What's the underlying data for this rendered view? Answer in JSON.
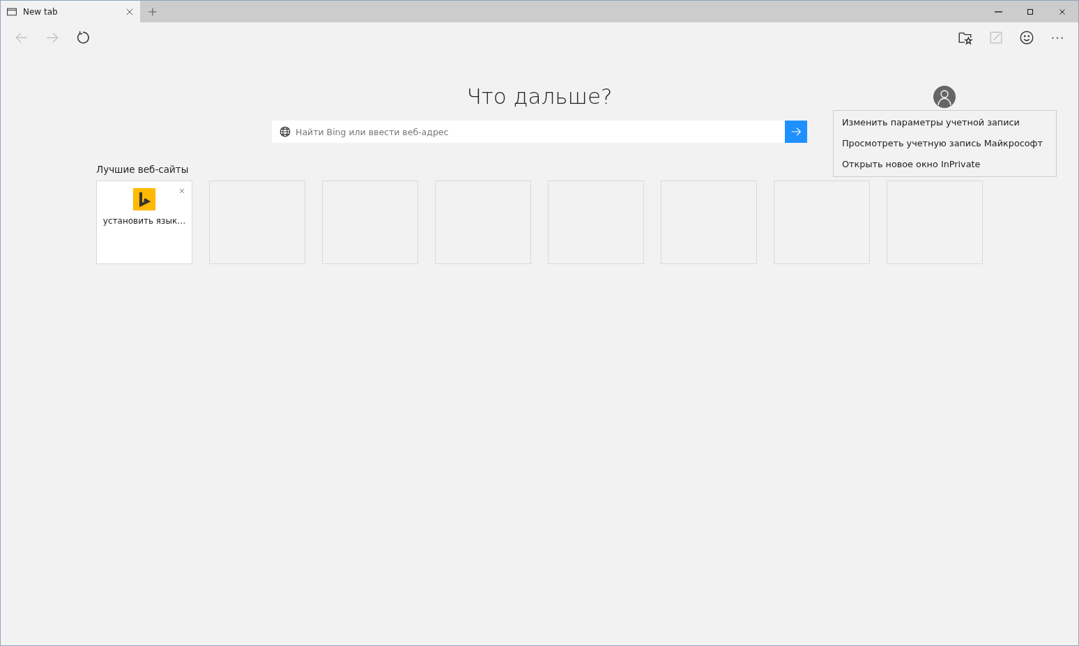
{
  "tab": {
    "title": "New tab",
    "selected": true
  },
  "toolbar": {
    "left": [
      {
        "kind": "back",
        "disabled": true
      },
      {
        "kind": "forward",
        "disabled": true
      },
      {
        "kind": "refresh",
        "disabled": false
      }
    ],
    "right": [
      {
        "kind": "favorites",
        "disabled": false
      },
      {
        "kind": "note",
        "disabled": true
      },
      {
        "kind": "feedback",
        "disabled": false
      },
      {
        "kind": "more",
        "disabled": false
      }
    ]
  },
  "heading": "Что дальше?",
  "search": {
    "placeholder": "Найти Bing или ввести веб-адрес"
  },
  "top_sites": {
    "title": "Лучшие веб-сайты",
    "tiles": [
      {
        "kind": "site",
        "label": "установить язык…"
      },
      {
        "kind": "empty"
      },
      {
        "kind": "empty"
      },
      {
        "kind": "empty"
      },
      {
        "kind": "empty"
      },
      {
        "kind": "empty"
      },
      {
        "kind": "empty"
      },
      {
        "kind": "empty"
      }
    ]
  },
  "account_menu": {
    "items": [
      "Изменить параметры учетной записи",
      "Просмотреть учетную запись Майкрософт",
      "Открыть новое окно InPrivate"
    ]
  }
}
